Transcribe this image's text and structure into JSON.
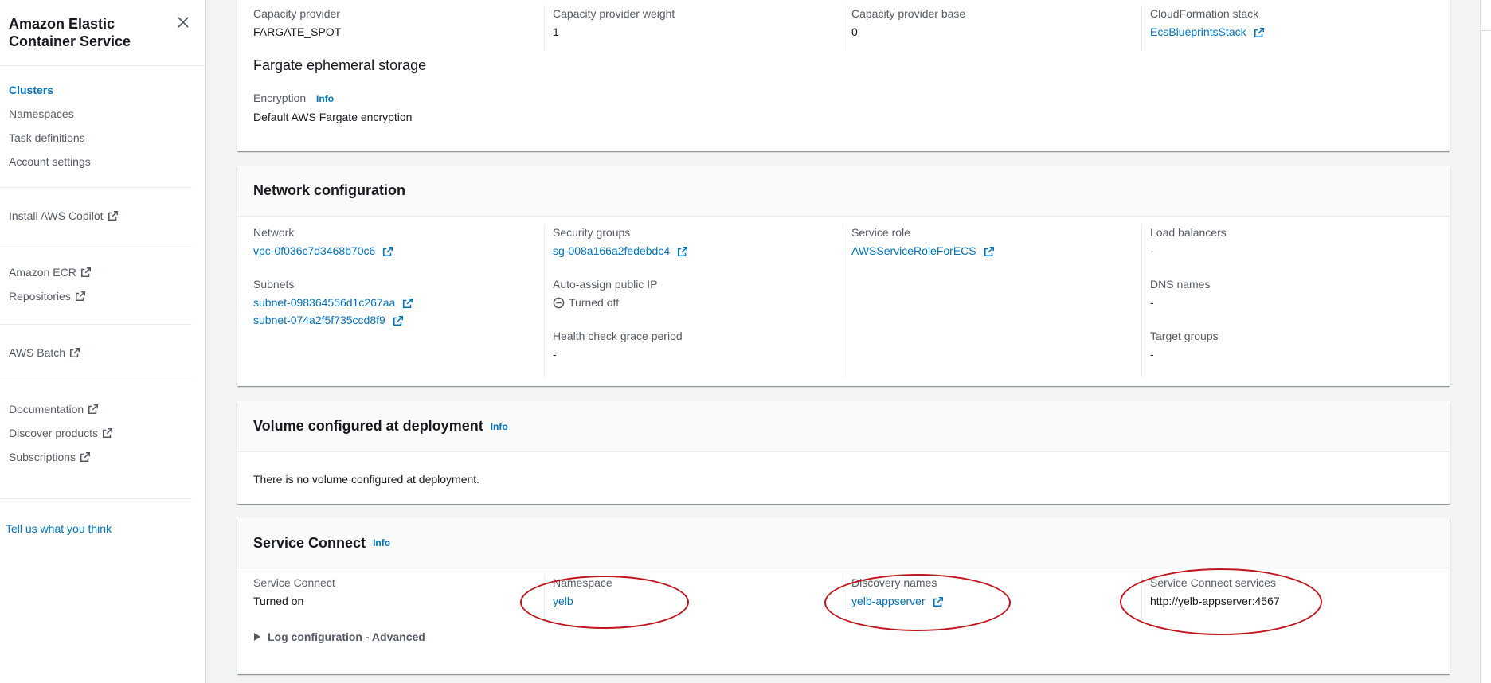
{
  "sidebar": {
    "title": "Amazon Elastic Container Service",
    "close_label": "Close navigation",
    "groups": [
      {
        "items": [
          {
            "label": "Clusters",
            "active": true,
            "external": false
          },
          {
            "label": "Namespaces",
            "active": false,
            "external": false
          },
          {
            "label": "Task definitions",
            "active": false,
            "external": false
          },
          {
            "label": "Account settings",
            "active": false,
            "external": false
          }
        ]
      },
      {
        "items": [
          {
            "label": "Install AWS Copilot",
            "active": false,
            "external": true
          }
        ]
      },
      {
        "items": [
          {
            "label": "Amazon ECR",
            "active": false,
            "external": true
          },
          {
            "label": "Repositories",
            "active": false,
            "external": true
          }
        ]
      },
      {
        "items": [
          {
            "label": "AWS Batch",
            "active": false,
            "external": true
          }
        ]
      },
      {
        "items": [
          {
            "label": "Documentation",
            "active": false,
            "external": true
          },
          {
            "label": "Discover products",
            "active": false,
            "external": true
          },
          {
            "label": "Subscriptions",
            "active": false,
            "external": true
          }
        ]
      }
    ],
    "feedback_link": "Tell us what you think"
  },
  "capacity_panel": {
    "fields": [
      {
        "label": "Capacity provider",
        "value": "FARGATE_SPOT",
        "link": false
      },
      {
        "label": "Capacity provider weight",
        "value": "1",
        "link": false
      },
      {
        "label": "Capacity provider base",
        "value": "0",
        "link": false
      },
      {
        "label": "CloudFormation stack",
        "value": "EcsBlueprintsStack",
        "link": true
      }
    ],
    "ephemeral_storage_title": "Fargate ephemeral storage",
    "encryption_label": "Encryption",
    "encryption_info": "Info",
    "encryption_value": "Default AWS Fargate encryption"
  },
  "network_panel": {
    "title": "Network configuration",
    "network_label": "Network",
    "network_value": "vpc-0f036c7d3468b70c6",
    "subnets_label": "Subnets",
    "subnets": [
      "subnet-098364556d1c267aa",
      "subnet-074a2f5f735ccd8f9"
    ],
    "security_groups_label": "Security groups",
    "security_groups_value": "sg-008a166a2fedebdc4",
    "auto_ip_label": "Auto-assign public IP",
    "auto_ip_value": "Turned off",
    "health_label": "Health check grace period",
    "health_value": "-",
    "service_role_label": "Service role",
    "service_role_value": "AWSServiceRoleForECS",
    "load_balancers_label": "Load balancers",
    "load_balancers_value": "-",
    "dns_label": "DNS names",
    "dns_value": "-",
    "target_groups_label": "Target groups",
    "target_groups_value": "-"
  },
  "volume_panel": {
    "title": "Volume configured at deployment",
    "info": "Info",
    "message": "There is no volume configured at deployment."
  },
  "service_connect_panel": {
    "title": "Service Connect",
    "info": "Info",
    "status_label": "Service Connect",
    "status_value": "Turned on",
    "namespace_label": "Namespace",
    "namespace_value": "yelb",
    "discovery_label": "Discovery names",
    "discovery_value": "yelb-appserver",
    "services_label": "Service Connect services",
    "services_value": "http://yelb-appserver:4567",
    "log_config_label": "Log configuration - Advanced"
  },
  "colors": {
    "link": "#0073bb",
    "annotation": "#c0161b",
    "background": "#f2f3f3"
  }
}
